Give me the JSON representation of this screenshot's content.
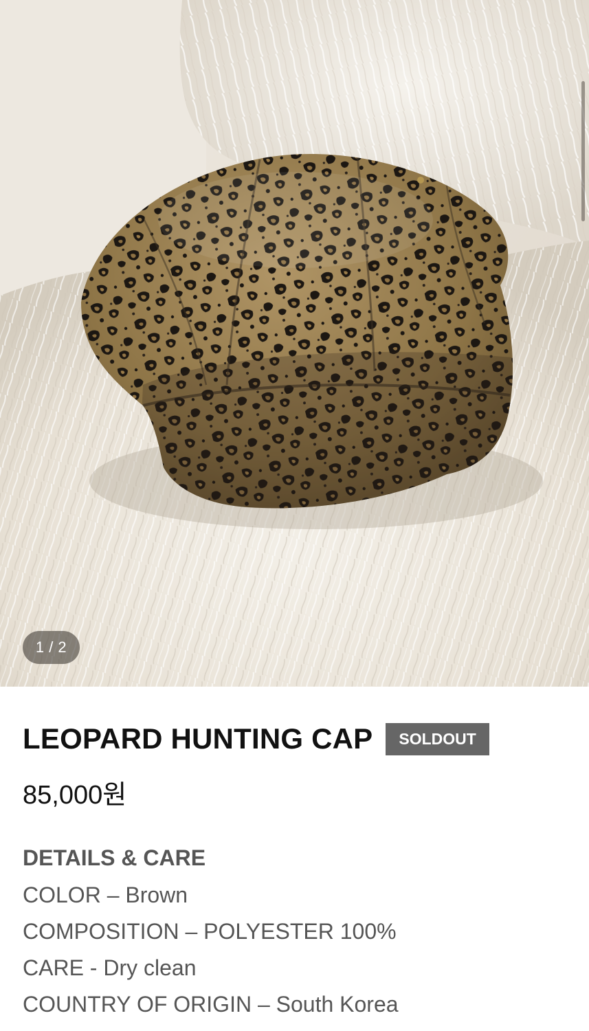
{
  "gallery": {
    "image_alt": "Leopard print hunting cap on white fur",
    "counter": "1 / 2",
    "current_image": 1,
    "total_images": 2
  },
  "product": {
    "title": "LEOPARD HUNTING CAP",
    "status_badge": "SOLDOUT",
    "price": "85,000원"
  },
  "details": {
    "heading": "DETAILS & CARE",
    "lines": [
      "COLOR – Brown",
      "COMPOSITION – POLYESTER 100%",
      "CARE - Dry clean",
      "COUNTRY OF ORIGIN – South Korea"
    ]
  },
  "colors": {
    "badge_background": "#666666",
    "title_text": "#111111",
    "details_text": "#555555",
    "counter_background": "#46403a"
  }
}
